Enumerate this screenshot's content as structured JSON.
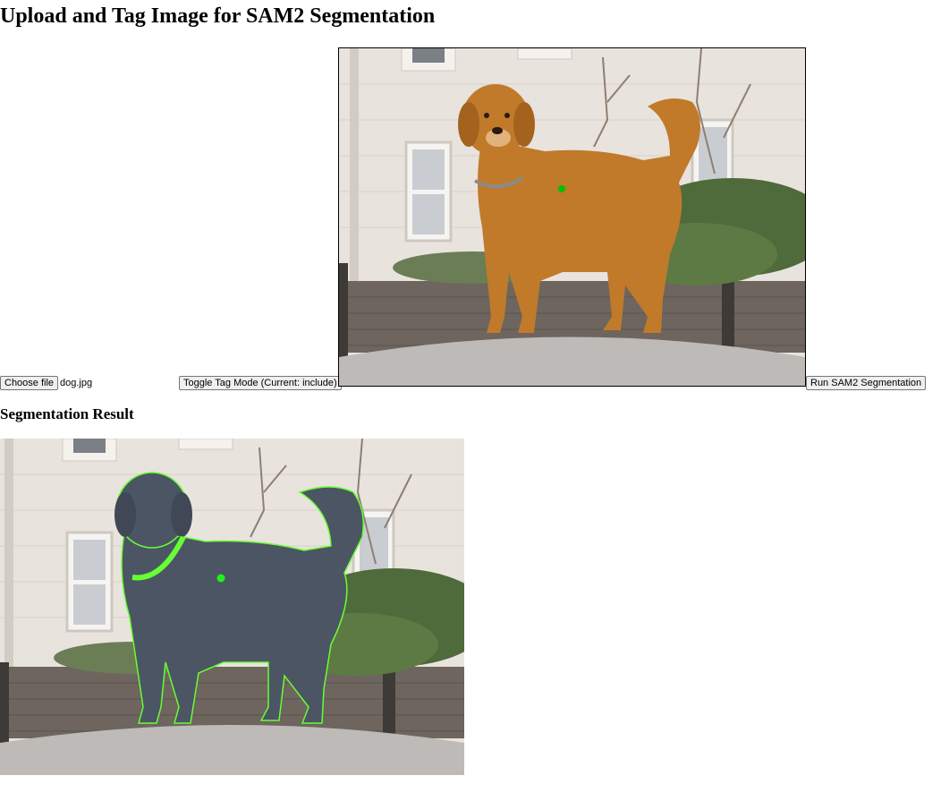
{
  "page": {
    "title": "Upload and Tag Image for SAM2 Segmentation",
    "result_heading": "Segmentation Result"
  },
  "controls": {
    "choose_file_label": "Choose file",
    "file_name": "dog.jpg",
    "toggle_label": "Toggle Tag Mode (Current: include)",
    "run_label": "Run SAM2 Segmentation"
  },
  "tag_point": {
    "mode": "include",
    "color": "#00c000"
  },
  "colors": {
    "mask_overlay": "#3a4a6a",
    "mask_edge": "#66ff33",
    "result_point": "#22ee22"
  }
}
